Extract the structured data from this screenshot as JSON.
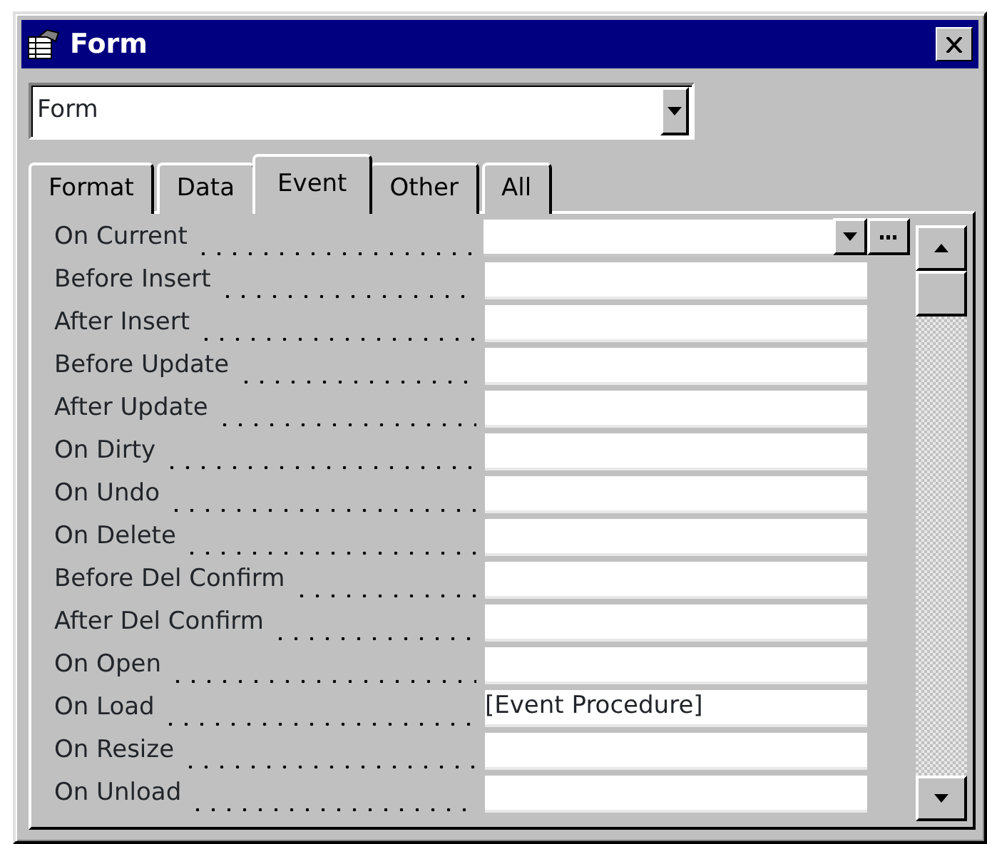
{
  "window": {
    "title": "Form"
  },
  "object_selector": {
    "value": "Form"
  },
  "tabs": [
    {
      "label": "Format",
      "selected": false
    },
    {
      "label": "Data",
      "selected": false
    },
    {
      "label": "Event",
      "selected": true
    },
    {
      "label": "Other",
      "selected": false
    },
    {
      "label": "All",
      "selected": false
    }
  ],
  "properties": [
    {
      "label": "On Current",
      "selected": true
    },
    {
      "label": "Before Insert",
      "selected": false
    },
    {
      "label": "After Insert",
      "selected": false
    },
    {
      "label": "Before Update",
      "selected": false
    },
    {
      "label": "After Update",
      "selected": false
    },
    {
      "label": "On Dirty",
      "selected": false
    },
    {
      "label": "On Undo",
      "selected": false
    },
    {
      "label": "On Delete",
      "selected": false
    },
    {
      "label": "Before Del Confirm",
      "selected": false
    },
    {
      "label": "After Del Confirm",
      "selected": false
    },
    {
      "label": "On Open",
      "selected": false
    },
    {
      "label": "On Load",
      "value": "[Event Procedure]",
      "selected": false
    },
    {
      "label": "On Resize",
      "selected": false
    },
    {
      "label": "On Unload",
      "selected": false
    }
  ]
}
